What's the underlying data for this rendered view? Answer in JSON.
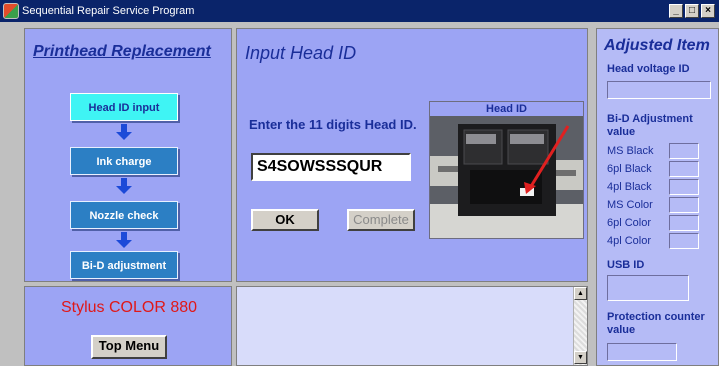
{
  "window": {
    "title": "Sequential Repair Service Program",
    "btn_min": "_",
    "btn_max": "□",
    "btn_close": "×"
  },
  "left": {
    "heading": "Printhead Replacement",
    "steps": [
      "Head ID input",
      "Ink charge",
      "Nozzle check",
      "Bi-D adjustment"
    ],
    "active_step": 0
  },
  "main": {
    "title": "Input Head ID",
    "prompt": "Enter the 11 digits Head ID.",
    "head_id_value": "S4SOWSSSQUR",
    "ok_label": "OK",
    "complete_label": "Complete",
    "photo_label": "Head ID"
  },
  "left_bottom": {
    "model": "Stylus COLOR 880",
    "top_menu_label": "Top Menu"
  },
  "right": {
    "title": "Adjusted Item",
    "head_voltage_label": "Head voltage ID",
    "bid_label": "Bi-D Adjustment value",
    "bid_rows": [
      "MS Black",
      "6pl Black",
      "4pl Black",
      "MS Color",
      "6pl Color",
      "4pl Color"
    ],
    "usb_label": "USB ID",
    "protection_label": "Protection counter value"
  },
  "colors": {
    "accent": "#1a2e99",
    "panel": "#9ca4f4",
    "model_text": "#e01818",
    "active_step": "#3ff4f4"
  }
}
